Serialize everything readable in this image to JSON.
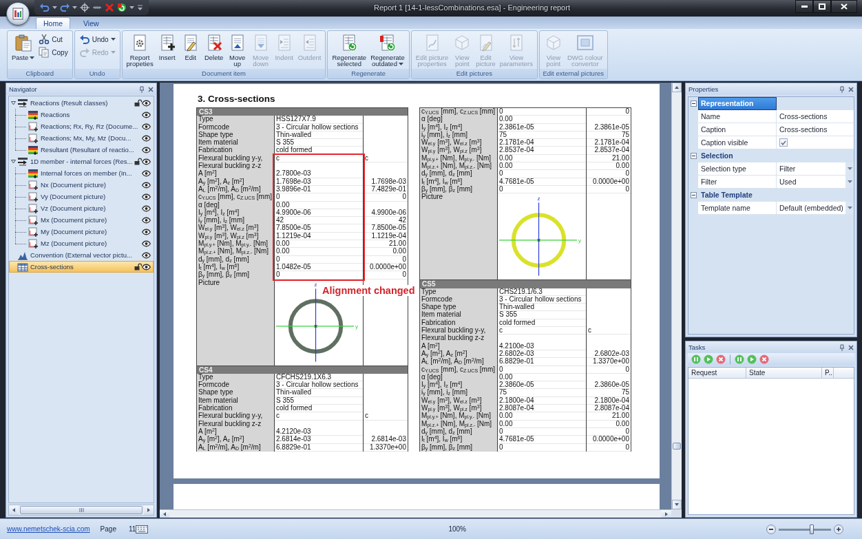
{
  "window": {
    "title": "Report 1 [14-1-lessCombinations.esa] - Engineering report"
  },
  "ribbon_tabs": [
    {
      "label": "Home",
      "selected": true
    },
    {
      "label": "View",
      "selected": false
    }
  ],
  "ribbon_groups": [
    {
      "title": "Clipboard",
      "buttons": [
        {
          "lines": [
            "Paste"
          ],
          "kind": "paste",
          "dropdown": true,
          "disabled": false
        }
      ],
      "small_buttons": [
        {
          "label": "Cut",
          "kind": "cut",
          "dropdown": false,
          "disabled": false
        },
        {
          "label": "Copy",
          "kind": "copy",
          "dropdown": false,
          "disabled": false
        }
      ]
    },
    {
      "title": "Undo",
      "small_buttons": [
        {
          "label": "Undo",
          "kind": "undo",
          "dropdown": true,
          "disabled": false
        },
        {
          "label": "Redo",
          "kind": "redo",
          "dropdown": true,
          "disabled": true
        }
      ]
    },
    {
      "title": "Document item",
      "buttons": [
        {
          "lines": [
            "Report",
            "propeties"
          ],
          "kind": "report-properties",
          "dropdown": false,
          "disabled": false
        },
        {
          "lines": [
            "Insert"
          ],
          "kind": "insert",
          "dropdown": false,
          "disabled": false
        },
        {
          "lines": [
            "Edit"
          ],
          "kind": "edit",
          "dropdown": false,
          "disabled": false
        },
        {
          "lines": [
            "Delete"
          ],
          "kind": "delete",
          "dropdown": false,
          "disabled": false
        },
        {
          "lines": [
            "Move",
            "up"
          ],
          "kind": "move-up",
          "dropdown": false,
          "disabled": false
        },
        {
          "lines": [
            "Move",
            "down"
          ],
          "kind": "move-down",
          "dropdown": false,
          "disabled": true
        },
        {
          "lines": [
            "Indent"
          ],
          "kind": "indent",
          "dropdown": false,
          "disabled": true
        },
        {
          "lines": [
            "Outdent"
          ],
          "kind": "outdent",
          "dropdown": false,
          "disabled": true
        }
      ]
    },
    {
      "title": "Regenerate",
      "buttons": [
        {
          "lines": [
            "Regenerate",
            "selected"
          ],
          "kind": "regenerate-selected",
          "dropdown": false,
          "disabled": false
        },
        {
          "lines": [
            "Regenerate",
            "outdated"
          ],
          "kind": "regenerate-outdated",
          "dropdown": true,
          "disabled": false
        }
      ]
    },
    {
      "title": "Edit pictures",
      "buttons": [
        {
          "lines": [
            "Edit picture",
            "properties"
          ],
          "kind": "picture-properties",
          "dropdown": false,
          "disabled": true
        },
        {
          "lines": [
            "View",
            "point"
          ],
          "kind": "view-point",
          "dropdown": false,
          "disabled": true
        },
        {
          "lines": [
            "Edit",
            "picture"
          ],
          "kind": "edit-picture",
          "dropdown": false,
          "disabled": true
        },
        {
          "lines": [
            "View",
            "parameters"
          ],
          "kind": "view-parameters",
          "dropdown": false,
          "disabled": true
        }
      ]
    },
    {
      "title": "Edit external pictures",
      "buttons": [
        {
          "lines": [
            "View",
            "point"
          ],
          "kind": "view-point",
          "dropdown": false,
          "disabled": true
        },
        {
          "lines": [
            "DWG colour",
            "convertor"
          ],
          "kind": "dwg-convertor",
          "dropdown": false,
          "disabled": true
        }
      ]
    }
  ],
  "navigator": {
    "title": "Navigator",
    "items": [
      {
        "label": "Reactions (Result classes)",
        "kind": "result-class",
        "lockable": true,
        "selected": false,
        "expanded": true,
        "children": [
          {
            "label": "Reactions",
            "kind": "table",
            "lockable": false,
            "selected": false
          },
          {
            "label": "Reactions; Rx, Ry, Rz (Docume...",
            "kind": "picture",
            "lockable": false,
            "selected": false
          },
          {
            "label": "Reactions; Mx, My, Mz (Docu...",
            "kind": "picture",
            "lockable": false,
            "selected": false
          },
          {
            "label": "Resultant (Resultant of reactio...",
            "kind": "table",
            "lockable": false,
            "selected": false
          }
        ]
      },
      {
        "label": "1D member - internal forces (Res...",
        "kind": "result-class",
        "lockable": true,
        "selected": false,
        "expanded": true,
        "children": [
          {
            "label": "Internal forces on member (In...",
            "kind": "table",
            "lockable": false,
            "selected": false
          },
          {
            "label": "Nx (Document picture)",
            "kind": "picture",
            "lockable": false,
            "selected": false
          },
          {
            "label": "Vy (Document picture)",
            "kind": "picture",
            "lockable": false,
            "selected": false
          },
          {
            "label": "Vz (Document picture)",
            "kind": "picture",
            "lockable": false,
            "selected": false
          },
          {
            "label": "Mx (Document picture)",
            "kind": "picture",
            "lockable": false,
            "selected": false
          },
          {
            "label": "My (Document picture)",
            "kind": "picture",
            "lockable": false,
            "selected": false
          },
          {
            "label": "Mz (Document picture)",
            "kind": "picture",
            "lockable": false,
            "selected": false
          }
        ]
      },
      {
        "label": "Convention (External vector pictu...",
        "kind": "vector",
        "lockable": false,
        "selected": false
      },
      {
        "label": "Cross-sections",
        "kind": "grid",
        "lockable": true,
        "selected": true
      }
    ]
  },
  "document": {
    "heading": "3. Cross-sections",
    "columns": [
      {
        "tables": [
          {
            "title": "CS3",
            "text_rows": [
              {
                "label": "Type",
                "value": "HSS127X7.9"
              },
              {
                "label": "Formcode",
                "value": "3 - Circular hollow sections"
              },
              {
                "label": "Shape type",
                "value": "Thin-walled"
              },
              {
                "label": "Item material",
                "value": "S 355"
              },
              {
                "label": "Fabrication",
                "value": "cold formed"
              },
              {
                "label": "Flexural buckling y-y,",
                "value": "c",
                "value_2": "c"
              },
              {
                "label": "Flexural buckling z-z"
              }
            ],
            "property_rows": [
              {
                "label": "A [m$^{2}$]",
                "value": "2.7800e-03"
              },
              {
                "label": "A$_{y}$ [m$^{2}$], A$_{z}$ [m$^{2}$]",
                "value": "1.7698e-03",
                "value_2": "1.7698e-03"
              },
              {
                "label": "A$_{L}$ [m$^{2}$/m], A$_{D}$ [m$^{2}$/m]",
                "value": "3.9896e-01",
                "value_2": "7.4829e-01"
              },
              {
                "label": "c$_{Y.UCS}$ [mm], c$_{Z.UCS}$ [mm]",
                "value": "0",
                "value_2": "0"
              },
              {
                "label": "α [deg]",
                "value": "0.00"
              },
              {
                "label": "I$_{y}$ [m$^{4}$], I$_{z}$ [m$^{4}$]",
                "value": "4.9900e-06",
                "value_2": "4.9900e-06"
              },
              {
                "label": "i$_{y}$ [mm], i$_{z}$ [mm]",
                "value": "42",
                "value_2": "42"
              },
              {
                "label": "W$_{el.y}$ [m$^{3}$], W$_{el.z}$ [m$^{3}$]",
                "value": "7.8500e-05",
                "value_2": "7.8500e-05"
              },
              {
                "label": "W$_{pl.y}$ [m$^{3}$], W$_{pl.z}$ [m$^{3}$]",
                "value": "1.1219e-04",
                "value_2": "1.1219e-04"
              },
              {
                "label": "M$_{pl.y.+}$ [Nm], M$_{pl.y.-}$ [Nm]",
                "value": "0.00",
                "value_2": "21.00"
              },
              {
                "label": "M$_{pl.z.+}$ [Nm], M$_{pl.z.-}$ [Nm]",
                "value": "0.00",
                "value_2": "0.00"
              },
              {
                "label": "d$_{y}$ [mm], d$_{z}$ [mm]",
                "value": "0",
                "value_2": "0"
              },
              {
                "label": "I$_{t}$ [m$^{4}$], I$_{w}$ [m$^{6}$]",
                "value": "1.0482e-05",
                "value_2": "0.0000e+00"
              },
              {
                "label": "β$_{y}$ [mm], β$_{z}$ [mm]",
                "value": "0",
                "value_2": "0"
              }
            ],
            "picture": {
              "label": "Picture",
              "vertical_axis": "z",
              "horizontal_axis": "y",
              "color": "#5f6f61"
            },
            "annotation": {
              "text": "Alignment changed"
            }
          },
          {
            "title": "CS4",
            "text_rows": [
              {
                "label": "Type",
                "value": "CFCHS219.1X6.3"
              },
              {
                "label": "Formcode",
                "value": "3 - Circular hollow sections"
              },
              {
                "label": "Shape type",
                "value": "Thin-walled"
              },
              {
                "label": "Item material",
                "value": "S 355"
              },
              {
                "label": "Fabrication",
                "value": "cold formed"
              },
              {
                "label": "Flexural buckling y-y,",
                "value": "c",
                "value_2": "c"
              },
              {
                "label": "Flexural buckling z-z"
              }
            ],
            "property_rows": [
              {
                "label": "A [m$^{2}$]",
                "value": "4.2120e-03"
              },
              {
                "label": "A$_{y}$ [m$^{2}$], A$_{z}$ [m$^{2}$]",
                "value": "2.6814e-03",
                "value_2": "2.6814e-03"
              },
              {
                "label": "A$_{L}$ [m$^{2}$/m], A$_{D}$ [m$^{2}$/m]",
                "value": "6.8829e-01",
                "value_2": "1.3370e+00"
              }
            ]
          }
        ]
      },
      {
        "tables": [
          {
            "property_rows": [
              {
                "label": "c$_{Y.UCS}$ [mm], c$_{Z.UCS}$ [mm]",
                "value": "0",
                "value_2": "0"
              },
              {
                "label": "α [deg]",
                "value": "0.00"
              },
              {
                "label": "I$_{y}$ [m$^{4}$], I$_{z}$ [m$^{4}$]",
                "value": "2.3861e-05",
                "value_2": "2.3861e-05"
              },
              {
                "label": "i$_{y}$ [mm], i$_{z}$ [mm]",
                "value": "75",
                "value_2": "75"
              },
              {
                "label": "W$_{el.y}$ [m$^{3}$], W$_{el.z}$ [m$^{3}$]",
                "value": "2.1781e-04",
                "value_2": "2.1781e-04"
              },
              {
                "label": "W$_{pl.y}$ [m$^{3}$], W$_{pl.z}$ [m$^{3}$]",
                "value": "2.8537e-04",
                "value_2": "2.8537e-04"
              },
              {
                "label": "M$_{pl.y.+}$ [Nm], M$_{pl.y.-}$ [Nm]",
                "value": "0.00",
                "value_2": "21.00"
              },
              {
                "label": "M$_{pl.z.+}$ [Nm], M$_{pl.z.-}$ [Nm]",
                "value": "0.00",
                "value_2": "0.00"
              },
              {
                "label": "d$_{y}$ [mm], d$_{z}$ [mm]",
                "value": "0",
                "value_2": "0"
              },
              {
                "label": "I$_{t}$ [m$^{4}$], I$_{w}$ [m$^{6}$]",
                "value": "4.7681e-05",
                "value_2": "0.0000e+00"
              },
              {
                "label": "β$_{y}$ [mm], β$_{z}$ [mm]",
                "value": "0",
                "value_2": "0"
              }
            ],
            "picture": {
              "label": "Picture",
              "vertical_axis": "z",
              "horizontal_axis": "y",
              "color": "#d9e22a"
            }
          },
          {
            "title": "CS5",
            "text_rows": [
              {
                "label": "Type",
                "value": "CHS219.1/6.3"
              },
              {
                "label": "Formcode",
                "value": "3 - Circular hollow sections"
              },
              {
                "label": "Shape type",
                "value": "Thin-walled"
              },
              {
                "label": "Item material",
                "value": "S 355"
              },
              {
                "label": "Fabrication",
                "value": "cold formed"
              },
              {
                "label": "Flexural buckling y-y,",
                "value": "c",
                "value_2": "c"
              },
              {
                "label": "Flexural buckling z-z"
              }
            ],
            "property_rows": [
              {
                "label": "A [m$^{2}$]",
                "value": "4.2100e-03"
              },
              {
                "label": "A$_{y}$ [m$^{2}$], A$_{z}$ [m$^{2}$]",
                "value": "2.6802e-03",
                "value_2": "2.6802e-03"
              },
              {
                "label": "A$_{L}$ [m$^{2}$/m], A$_{D}$ [m$^{2}$/m]",
                "value": "6.8829e-01",
                "value_2": "1.3370e+00"
              },
              {
                "label": "c$_{Y.UCS}$ [mm], c$_{Z.UCS}$ [mm]",
                "value": "0",
                "value_2": "0"
              },
              {
                "label": "α [deg]",
                "value": "0.00"
              },
              {
                "label": "I$_{y}$ [m$^{4}$], I$_{z}$ [m$^{4}$]",
                "value": "2.3860e-05",
                "value_2": "2.3860e-05"
              },
              {
                "label": "i$_{y}$ [mm], i$_{z}$ [mm]",
                "value": "75",
                "value_2": "75"
              },
              {
                "label": "W$_{el.y}$ [m$^{3}$], W$_{el.z}$ [m$^{3}$]",
                "value": "2.1800e-04",
                "value_2": "2.1800e-04"
              },
              {
                "label": "W$_{pl.y}$ [m$^{3}$], W$_{pl.z}$ [m$^{3}$]",
                "value": "2.8087e-04",
                "value_2": "2.8087e-04"
              },
              {
                "label": "M$_{pl.y.+}$ [Nm], M$_{pl.y.-}$ [Nm]",
                "value": "0.00",
                "value_2": "21.00"
              },
              {
                "label": "M$_{pl.z.+}$ [Nm], M$_{pl.z.-}$ [Nm]",
                "value": "0.00",
                "value_2": "0.00"
              },
              {
                "label": "d$_{y}$ [mm], d$_{z}$ [mm]",
                "value": "0",
                "value_2": "0"
              },
              {
                "label": "I$_{t}$ [m$^{4}$], I$_{w}$ [m$^{6}$]",
                "value": "4.7681e-05",
                "value_2": "0.0000e+00"
              },
              {
                "label": "β$_{y}$ [mm], β$_{z}$ [mm]",
                "value": "0",
                "value_2": "0"
              }
            ]
          }
        ]
      }
    ]
  },
  "properties": {
    "title": "Properties",
    "categories": [
      {
        "title": "Representation",
        "selected": true,
        "expanded": true,
        "rows": [
          {
            "label": "Name",
            "kind": "text",
            "value": "Cross-sections"
          },
          {
            "label": "Caption",
            "kind": "text",
            "value": "Cross-sections"
          },
          {
            "label": "Caption visible",
            "kind": "checkbox",
            "checked": true
          }
        ]
      },
      {
        "title": "Selection",
        "selected": false,
        "expanded": true,
        "rows": [
          {
            "label": "Selection type",
            "kind": "dropdown",
            "value": "Filter"
          },
          {
            "label": "Filter",
            "kind": "dropdown",
            "value": "Used"
          }
        ]
      },
      {
        "title": "Table Template",
        "selected": false,
        "expanded": true,
        "rows": [
          {
            "label": "Template name",
            "kind": "dropdown",
            "value": "Default (embedded)"
          }
        ]
      }
    ]
  },
  "tasks": {
    "title": "Tasks",
    "columns": [
      "Request",
      "State",
      "P.."
    ]
  },
  "status_bar": {
    "link": "www.nemetschek-scia.com",
    "page_label": "Page",
    "page_number": "11",
    "zoom": "100%",
    "zoom_slider": {
      "level": 0.63
    }
  }
}
